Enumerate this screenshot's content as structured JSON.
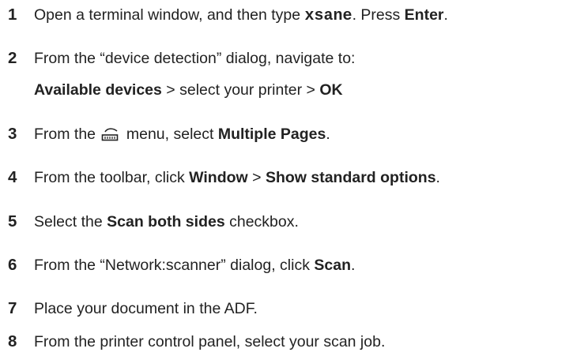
{
  "steps": [
    {
      "number": "1",
      "parts": {
        "a": "Open a terminal window, and then type ",
        "b": "xsane",
        "c": ". Press ",
        "d": "Enter",
        "e": "."
      }
    },
    {
      "number": "2",
      "parts": {
        "a": "From the “device detection” dialog, navigate to:",
        "b": "Available devices",
        "c": " > select your printer  > ",
        "d": "OK"
      }
    },
    {
      "number": "3",
      "icon": "scanner-icon",
      "parts": {
        "a": "From the ",
        "b": " menu, select ",
        "c": "Multiple Pages",
        "d": "."
      }
    },
    {
      "number": "4",
      "parts": {
        "a": "From the toolbar, click ",
        "b": "Window",
        "c": " > ",
        "d": "Show standard options",
        "e": "."
      }
    },
    {
      "number": "5",
      "parts": {
        "a": "Select the ",
        "b": "Scan both sides",
        "c": " checkbox."
      }
    },
    {
      "number": "6",
      "parts": {
        "a": "From the “Network:scanner” dialog, click ",
        "b": "Scan",
        "c": "."
      }
    },
    {
      "number": "7",
      "parts": {
        "a": "Place your document in the ADF."
      }
    },
    {
      "number": "8",
      "parts": {
        "a": "From the printer control panel, select your scan job."
      }
    }
  ]
}
